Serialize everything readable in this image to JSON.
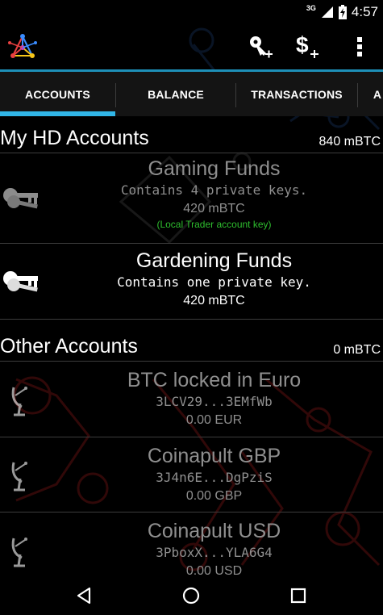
{
  "status_bar": {
    "network": "3G",
    "time": "4:57"
  },
  "action_bar": {
    "logo_icon": "mycelium-logo-icon",
    "add_key_icon": "key-plus-icon",
    "add_currency_icon": "dollar-plus-icon",
    "overflow_icon": "overflow-menu-icon"
  },
  "tabs": [
    {
      "label": "ACCOUNTS",
      "selected": true
    },
    {
      "label": "BALANCE",
      "selected": false
    },
    {
      "label": "TRANSACTIONS",
      "selected": false
    },
    {
      "label": "A",
      "selected": false
    }
  ],
  "sections": {
    "hd": {
      "title": "My HD Accounts",
      "total": "840 mBTC",
      "accounts": [
        {
          "name": "Gaming Funds",
          "detail": "Contains 4 private keys.",
          "balance": "420 mBTC",
          "note": "(Local Trader account key)",
          "icon": "keys-icon",
          "active": false
        },
        {
          "name": "Gardening Funds",
          "detail": "Contains one private key.",
          "balance": "420 mBTC",
          "note": "",
          "icon": "keys-icon",
          "active": true
        }
      ]
    },
    "other": {
      "title": "Other Accounts",
      "total": "0 mBTC",
      "accounts": [
        {
          "name": "BTC locked in Euro",
          "detail": "3LCV29...3EMfWb",
          "balance": "0.00 EUR",
          "icon": "satellite-dish-icon"
        },
        {
          "name": "Coinapult GBP",
          "detail": "3J4n6E...DgPziS",
          "balance": "0.00 GBP",
          "icon": "satellite-dish-icon"
        },
        {
          "name": "Coinapult USD",
          "detail": "3PboxX...YLA6G4",
          "balance": "0.00 USD",
          "icon": "satellite-dish-icon"
        }
      ]
    }
  },
  "nav_bar": {
    "back_icon": "back-icon",
    "home_icon": "home-icon",
    "recents_icon": "recents-icon"
  },
  "colors": {
    "accent": "#31b6e7",
    "note_green": "#2ebd2e",
    "dim_text": "#8f8f8f",
    "background": "#000000"
  }
}
